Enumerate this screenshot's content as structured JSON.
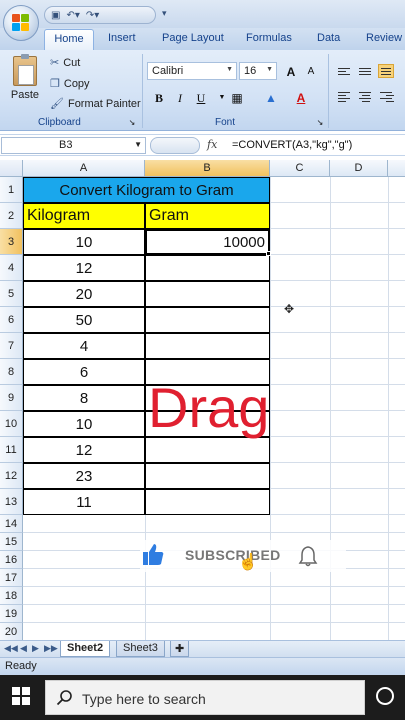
{
  "qat": {
    "icons": [
      "save-icon",
      "undo-icon",
      "redo-icon"
    ]
  },
  "tabs": [
    "Home",
    "Insert",
    "Page Layout",
    "Formulas",
    "Data",
    "Review"
  ],
  "clipboard": {
    "paste": "Paste",
    "cut": "Cut",
    "copy": "Copy",
    "format_painter": "Format Painter",
    "label": "Clipboard"
  },
  "font": {
    "name": "Calibri",
    "size": "16",
    "label": "Font",
    "bold": "B",
    "italic": "I",
    "underline": "U",
    "grow": "A",
    "shrink": "A"
  },
  "formula_bar": {
    "name_box": "B3",
    "fx": "fx",
    "formula": "=CONVERT(A3,\"kg\",\"g\")"
  },
  "columns": [
    "A",
    "B",
    "C",
    "D"
  ],
  "rows": [
    "1",
    "2",
    "3",
    "4",
    "5",
    "6",
    "7",
    "8",
    "9",
    "10",
    "11",
    "12",
    "13",
    "14",
    "15",
    "16",
    "17",
    "18",
    "19",
    "20"
  ],
  "table": {
    "title": "Convert Kilogram to Gram",
    "header_a": "Kilogram",
    "header_b": "Gram",
    "kilograms": [
      "10",
      "12",
      "20",
      "50",
      "4",
      "6",
      "8",
      "10",
      "12",
      "23",
      "11"
    ],
    "b3_value": "10000"
  },
  "overlay": {
    "drag": "Drag",
    "subscribed": "SUBSCRIBED"
  },
  "sheets": [
    "Sheet2",
    "Sheet3"
  ],
  "status": "Ready",
  "taskbar": {
    "search_placeholder": "Type here to search"
  },
  "colors": {
    "title_fill": "#1aa7ec",
    "header_fill": "#ffff00",
    "drag_text": "#e02030",
    "thumb": "#2f7de1"
  }
}
